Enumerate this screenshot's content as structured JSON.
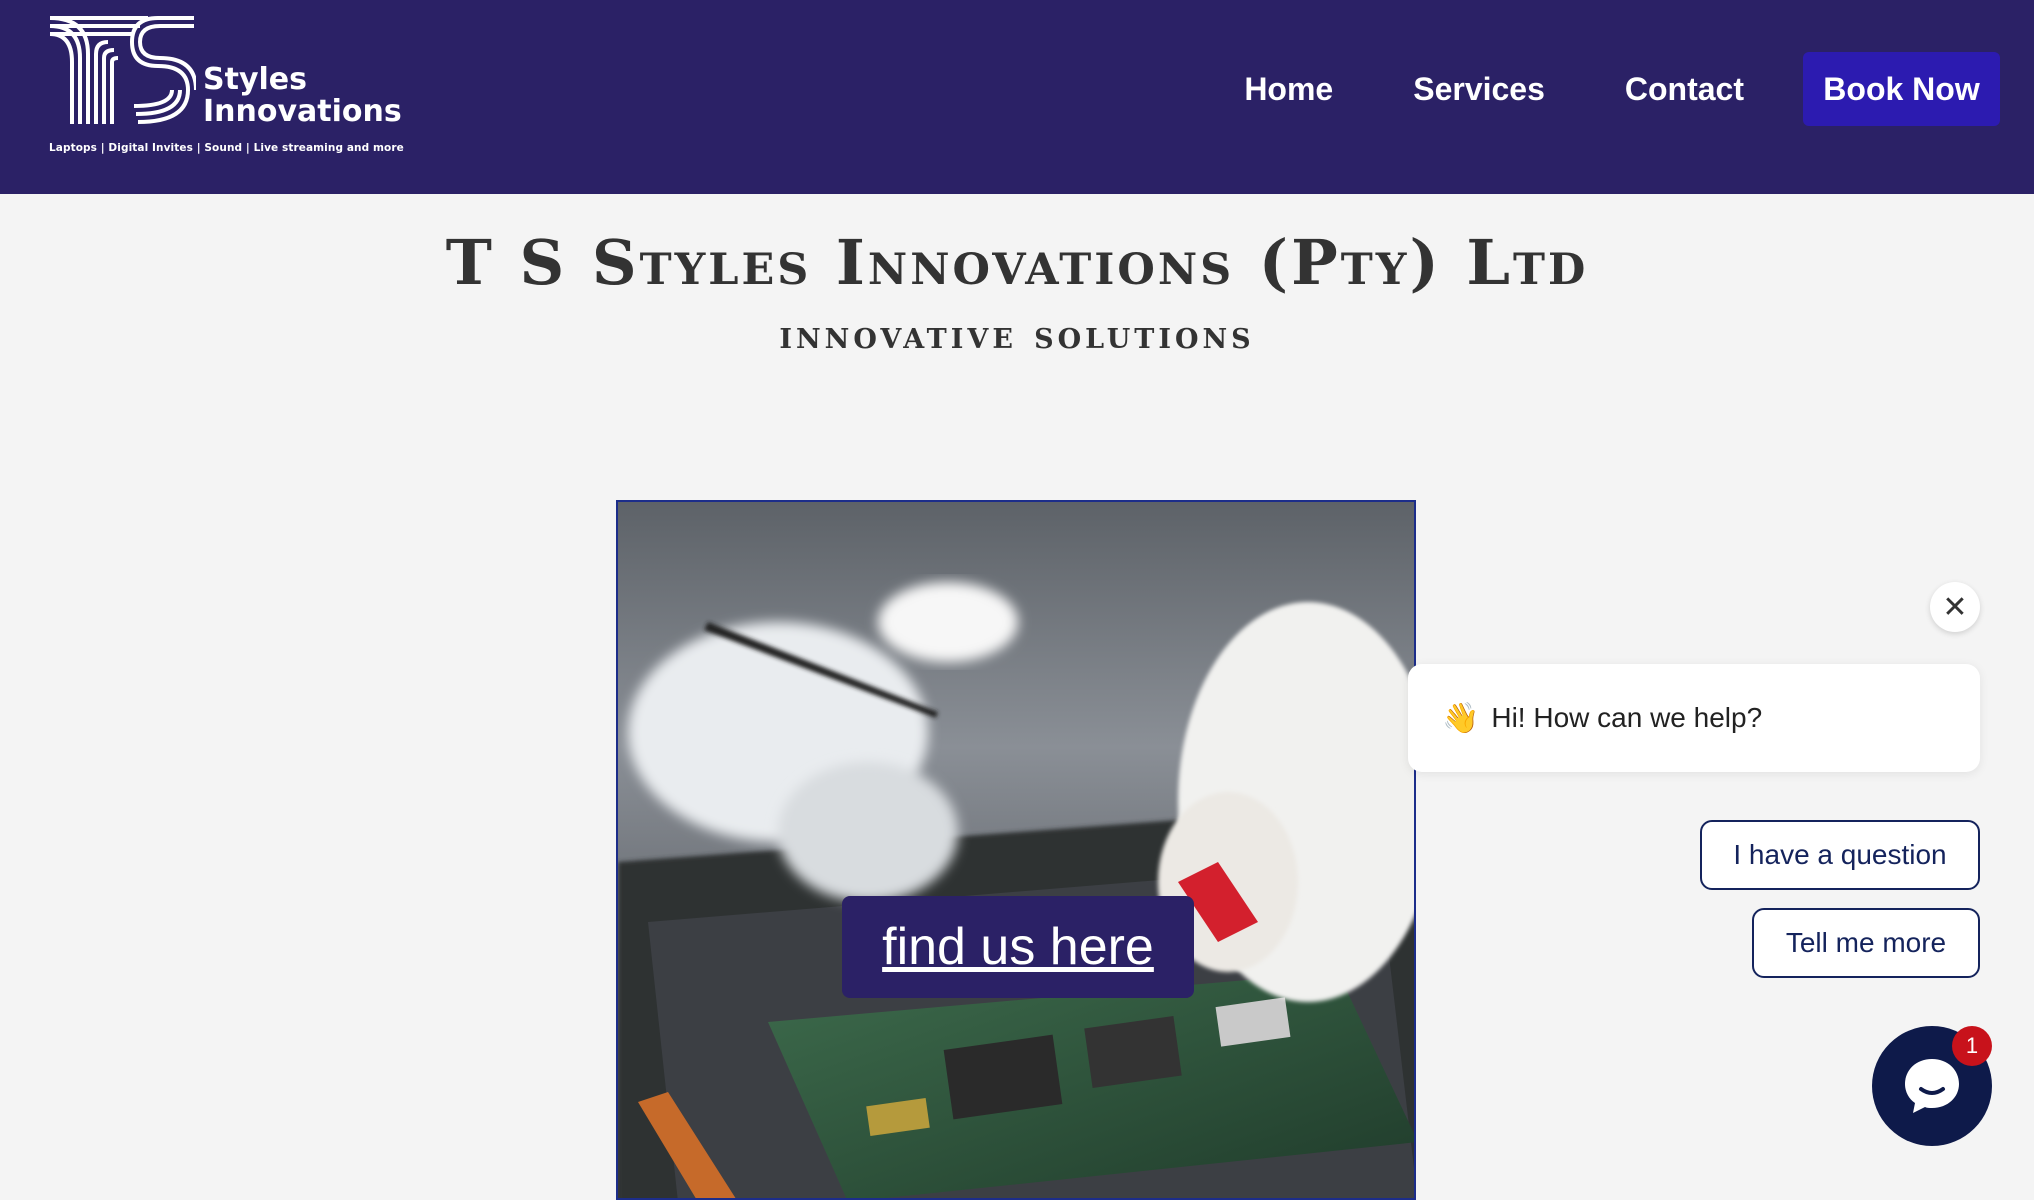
{
  "brand": {
    "name_line1": "Styles",
    "name_line2": "Innovations",
    "tagline": "Laptops | Digital Invites | Sound | Live streaming and more"
  },
  "nav": {
    "items": [
      {
        "label": "Home"
      },
      {
        "label": "Services"
      },
      {
        "label": "Contact"
      }
    ],
    "cta_label": "Book Now"
  },
  "hero": {
    "title": "T S Styles Innovations (Pty) Ltd",
    "subtitle": "innovative solutions",
    "image_icon": "laptop-repair-photo",
    "button_label": "find us here"
  },
  "chat": {
    "greeting_emoji": "👋",
    "greeting": "Hi! How can we help?",
    "quick_replies": [
      "I have a question",
      "Tell me more"
    ],
    "close_icon": "close-icon",
    "launcher_icon": "chat-bubble-icon",
    "unread_count": "1"
  },
  "colors": {
    "header_bg": "#2b2166",
    "cta_bg": "#2c1bb0",
    "page_bg": "#f4f4f4",
    "chat_launcher": "#0e1a4a",
    "badge": "#c8121b"
  }
}
